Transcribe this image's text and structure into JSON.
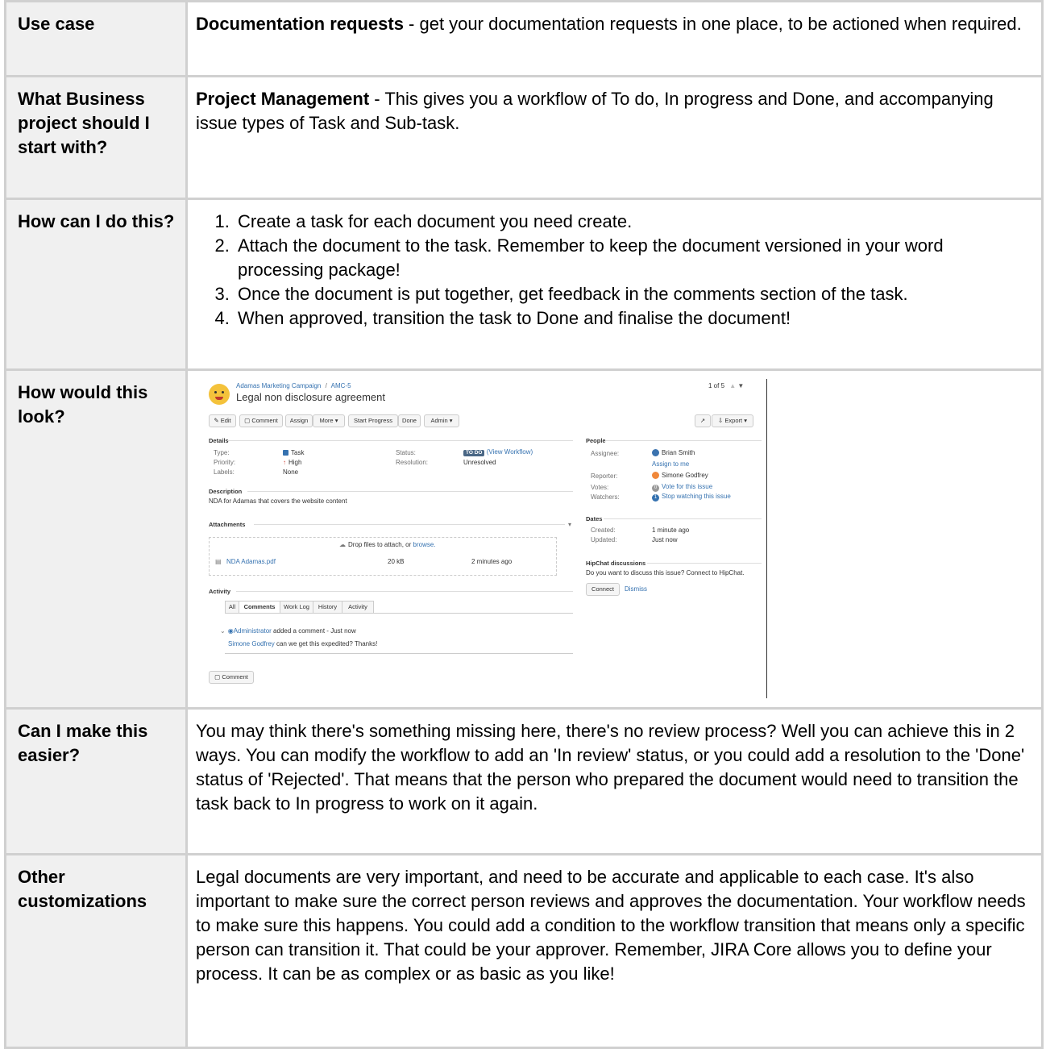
{
  "rows": [
    {
      "header": "Use case",
      "lead": "Documentation requests",
      "text": " - get your documentation requests in one place, to be actioned when required."
    },
    {
      "header": "What Business project should I start with?",
      "lead": "Project Management",
      "text": " - This gives you a workflow of To do, In progress and Done, and accompanying issue types of Task and Sub-task."
    },
    {
      "header": "How can I do this?",
      "steps": [
        "Create a task for each document you need create.",
        "Attach the document to the task. Remember to keep the document versioned in your word processing package!",
        "Once the document is put together, get feedback in the comments section of the task.",
        "When approved, transition the task to Done and finalise the document!"
      ]
    },
    {
      "header": "How would this look?"
    },
    {
      "header": "Can I make this easier?",
      "text": "You may think there's something missing here, there's no review process? Well you can achieve this in 2 ways. You can modify the workflow to add an 'In review' status, or you could add a resolution to the 'Done' status of 'Rejected'. That means that the person who prepared the document would need to transition the task back to In progress to work on it again."
    },
    {
      "header": "Other customizations",
      "text": "Legal documents are very important, and need to be accurate and applicable to each case. It's also important to make sure the correct person reviews and approves the documentation. Your workflow needs to make sure this happens. You could add a condition to the workflow transition that means only a specific person can transition it. That could be your approver. Remember, JIRA Core allows you to define your process. It can be as complex or as basic as you like!"
    }
  ],
  "issue": {
    "project": "Adamas Marketing Campaign",
    "sep": "/",
    "key": "AMC-5",
    "pager": "1 of 5",
    "summary": "Legal non disclosure agreement",
    "buttons": {
      "edit": "Edit",
      "comment": "Comment",
      "assign": "Assign",
      "more": "More",
      "start": "Start Progress",
      "done": "Done",
      "admin": "Admin",
      "export": "Export"
    },
    "details": {
      "heading": "Details",
      "type_label": "Type:",
      "type_value": "Task",
      "priority_label": "Priority:",
      "priority_value": "High",
      "labels_label": "Labels:",
      "labels_value": "None",
      "status_label": "Status:",
      "status_value": "TO DO",
      "status_link": "(View Workflow)",
      "resolution_label": "Resolution:",
      "resolution_value": "Unresolved"
    },
    "description": {
      "heading": "Description",
      "text": "NDA for Adamas that covers the website content"
    },
    "attachments": {
      "heading": "Attachments",
      "drop": "Drop files to attach, or",
      "browse": "browse.",
      "file": "NDA Adamas.pdf",
      "size": "20 kB",
      "age": "2 minutes ago"
    },
    "activity": {
      "heading": "Activity",
      "tabs": [
        "All",
        "Comments",
        "Work Log",
        "History",
        "Activity"
      ],
      "author": "Administrator",
      "action": "added a comment - Just now",
      "mention": "Simone Godfrey",
      "body": "can we get this expedited? Thanks!",
      "comment_button": "Comment"
    },
    "people": {
      "heading": "People",
      "assignee_label": "Assignee:",
      "assignee": "Brian Smith",
      "assign_me": "Assign to me",
      "reporter_label": "Reporter:",
      "reporter": "Simone Godfrey",
      "votes_label": "Votes:",
      "votes_count": "0",
      "votes_link": "Vote for this issue",
      "watchers_label": "Watchers:",
      "watchers_count": "1",
      "watchers_link": "Stop watching this issue"
    },
    "dates": {
      "heading": "Dates",
      "created_label": "Created:",
      "created": "1 minute ago",
      "updated_label": "Updated:",
      "updated": "Just now"
    },
    "hipchat": {
      "heading": "HipChat discussions",
      "text": "Do you want to discuss this issue? Connect to HipChat.",
      "connect": "Connect",
      "dismiss": "Dismiss"
    }
  },
  "colors": {
    "link": "#3572b0",
    "header_bg": "#f0f0f0",
    "border": "#d0d0d0",
    "status_lozenge": "#4a6785"
  }
}
